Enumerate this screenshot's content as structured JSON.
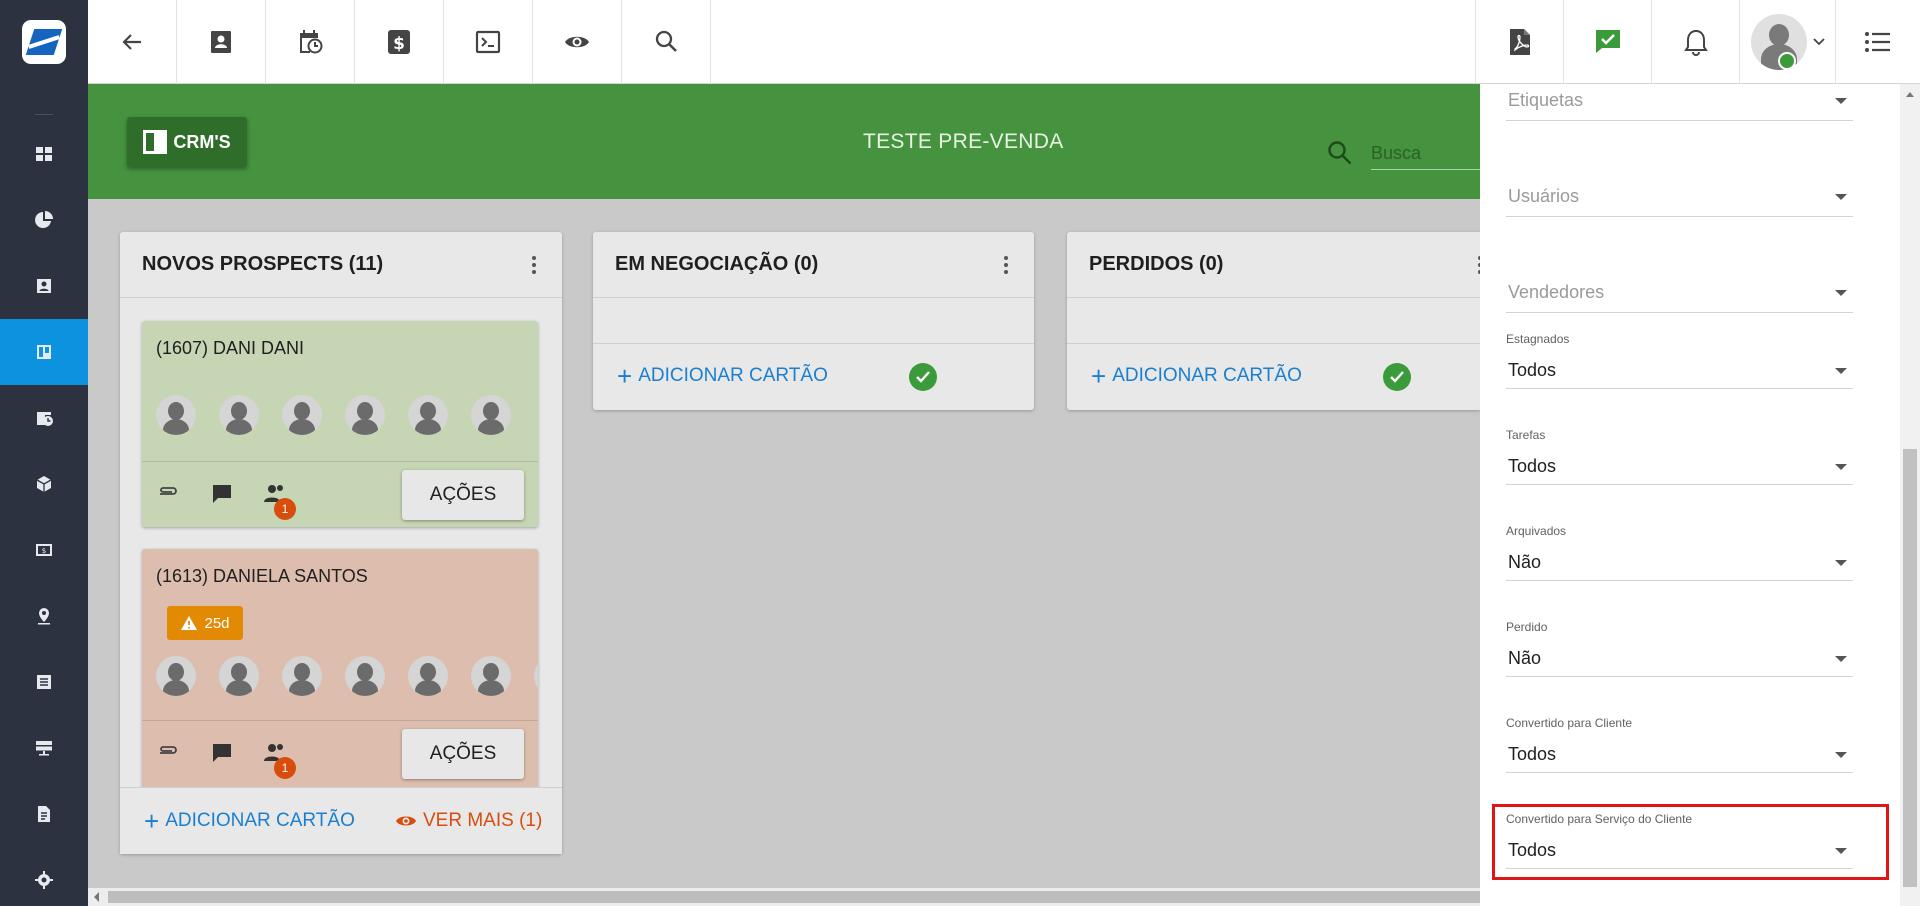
{
  "board": {
    "crm_label": "CRM'S",
    "title": "TESTE PRE-VENDA",
    "search_placeholder": "Busca"
  },
  "columns": [
    {
      "title": "NOVOS PROSPECTS (11)",
      "add_label": "ADICIONAR CARTÃO",
      "more_label": "VER MAIS (1)",
      "cards": [
        {
          "title": "(1607) DANI DANI",
          "color": "#c6d5b3",
          "badge": "1",
          "action": "AÇÕES"
        },
        {
          "title": "(1613) DANIELA SANTOS",
          "color": "#ddbeae",
          "warning": "25d",
          "badge": "1",
          "action": "AÇÕES"
        }
      ]
    },
    {
      "title": "EM NEGOCIAÇÃO (0)",
      "add_label": "ADICIONAR CARTÃO"
    },
    {
      "title": "PERDIDOS (0)",
      "add_label": "ADICIONAR CARTÃO"
    }
  ],
  "filters": {
    "etiquetas": {
      "placeholder": "Etiquetas"
    },
    "usuarios": {
      "placeholder": "Usuários"
    },
    "vendedores": {
      "placeholder": "Vendedores"
    },
    "estagnados": {
      "label": "Estagnados",
      "value": "Todos"
    },
    "tarefas": {
      "label": "Tarefas",
      "value": "Todos"
    },
    "arquivados": {
      "label": "Arquivados",
      "value": "Não"
    },
    "perdido": {
      "label": "Perdido",
      "value": "Não"
    },
    "convertido_cliente": {
      "label": "Convertido para Cliente",
      "value": "Todos"
    },
    "convertido_servico": {
      "label": "Convertido para Serviço do Cliente",
      "value": "Todos"
    }
  },
  "colors": {
    "sidebar": "#2c3240",
    "sidebar_active": "#0d92e0",
    "header_green": "#45923f",
    "link_blue": "#1a7fd0",
    "danger_orange": "#d94d0c",
    "highlight_red": "#e01515"
  },
  "icons": {
    "topbar": [
      "back-arrow-icon",
      "contact-card-icon",
      "calendar-clock-icon",
      "dollar-icon",
      "terminal-icon",
      "eye-icon",
      "search-icon"
    ],
    "topbar_right": [
      "pdf-icon",
      "chat-check-icon",
      "bell-icon",
      "user-avatar-icon",
      "menu-list-icon"
    ],
    "sidebar": [
      "dashboard-icon",
      "pie-chart-icon",
      "contact-icon",
      "kanban-icon",
      "schedule-icon",
      "box-icon",
      "money-icon",
      "location-icon",
      "list-icon",
      "server-icon",
      "document-icon",
      "settings-icon"
    ]
  }
}
